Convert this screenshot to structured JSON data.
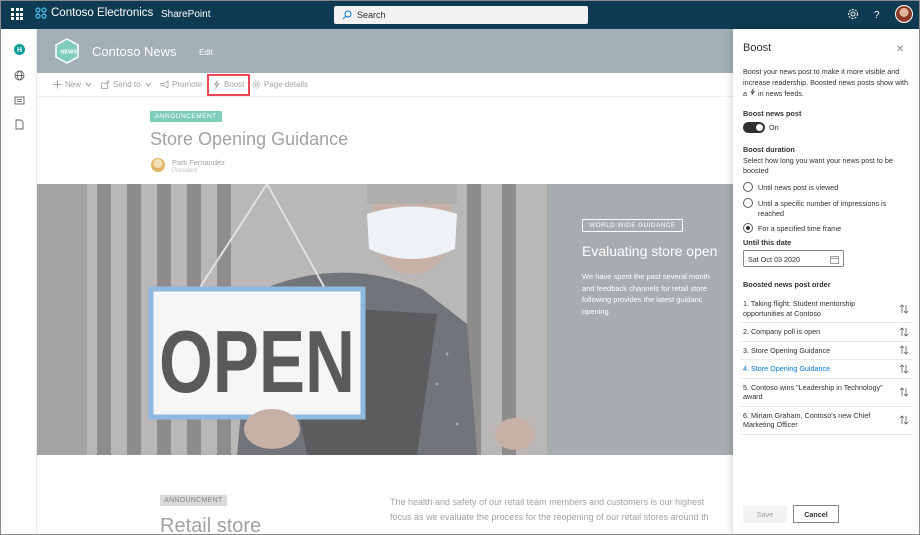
{
  "suitebar": {
    "org_name": "Contoso Electronics",
    "app_name": "SharePoint",
    "search_placeholder": "Search",
    "icons": [
      "app-launcher-icon",
      "search-icon",
      "settings-icon",
      "help-icon"
    ]
  },
  "rail": {
    "icons": [
      "home-icon",
      "globe-icon",
      "news-icon",
      "document-icon"
    ]
  },
  "site": {
    "logo_text": "NEWS",
    "title": "Contoso News",
    "edit_label": "Edit"
  },
  "commandbar": {
    "new_label": "New",
    "send_label": "Send to",
    "promote_label": "Promote",
    "boost_label": "Boost",
    "details_label": "Page details"
  },
  "article": {
    "badge": "ANNOUNCEMENT",
    "title": "Store Opening Guidance",
    "author": "Patti Fernandez",
    "author_role": "President",
    "hero_sign_text": "OPEN",
    "side_badge": "WORLD WIDE GUIDANCE",
    "side_title": "Evaluating store open",
    "side_body": [
      "We have spent the past several month",
      "and feedback channels for retail store",
      "following provides the latest guidanc",
      "opening."
    ],
    "section_badge": "ANNOUNCMENT",
    "section_title": "Retail store",
    "section_body": [
      "The health and safety of our retail team members and customers is our highest",
      "focus as we evaluate the process for the reopening of our retail stores around th"
    ]
  },
  "panel": {
    "title": "Boost",
    "close_label": "✕",
    "description": "Boost your news post to make it more visible and increase readership. Boosted news posts show with a",
    "description_end": "in news feeds.",
    "toggle_label": "Boost news post",
    "toggle_state": "On",
    "duration_label": "Boost duration",
    "duration_sub": "Select how long you want your news post to be boosted",
    "options": [
      "Until news post is viewed",
      "Until a specific number of impressions is reached",
      "For a specified time frame"
    ],
    "selected_option": 2,
    "until_label": "Until this date",
    "date_value": "Sat Oct 03 2020",
    "order_label": "Boosted news post order",
    "order_items": [
      "1. Taking flight: Student mentorship opportunities at Contoso",
      "2. Company poll is open",
      "3. Store Opening Guidance",
      "4. Store Opening Guidance",
      "5. Contoso wins \"Leadership in Technology\" award",
      "6. Miriam Graham, Contoso's new Chief Marketing Officer"
    ],
    "active_order_item": 3,
    "save_label": "Save",
    "cancel_label": "Cancel"
  },
  "colors": {
    "suitebar": "#0f3b52",
    "site_header": "#8a99a3",
    "badge": "#5dbfa8",
    "highlight": "#e81123",
    "link": "#0078d4"
  }
}
